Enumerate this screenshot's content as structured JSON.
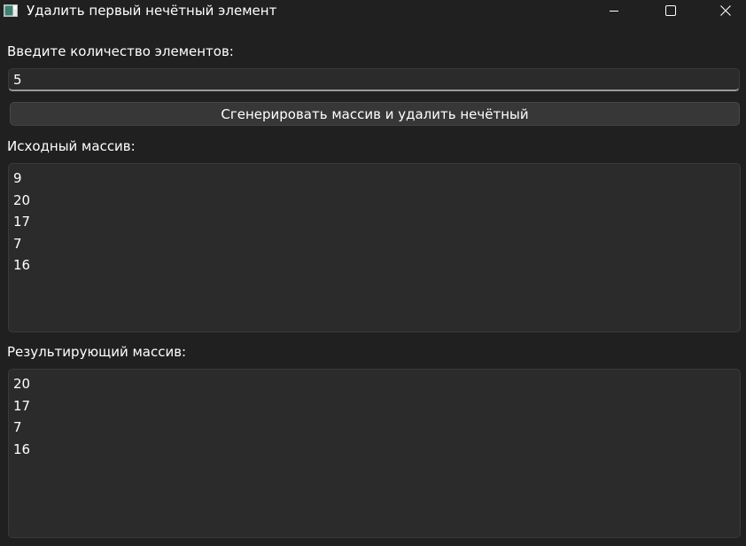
{
  "window": {
    "title": "Удалить первый нечётный элемент",
    "controls": [
      "minimize-icon",
      "maximize-icon",
      "close-icon"
    ]
  },
  "form": {
    "count_label": "Введите количество элементов:",
    "count_value": "5",
    "generate_button": "Сгенерировать массив и удалить нечётный"
  },
  "source": {
    "label": "Исходный массив:",
    "items": [
      "9",
      "20",
      "17",
      "7",
      "16"
    ]
  },
  "result": {
    "label": "Результирующий массив:",
    "items": [
      "20",
      "17",
      "7",
      "16"
    ]
  },
  "colors": {
    "background": "#202020",
    "field": "#2b2b2b",
    "button": "#373737",
    "text": "#ffffff"
  }
}
